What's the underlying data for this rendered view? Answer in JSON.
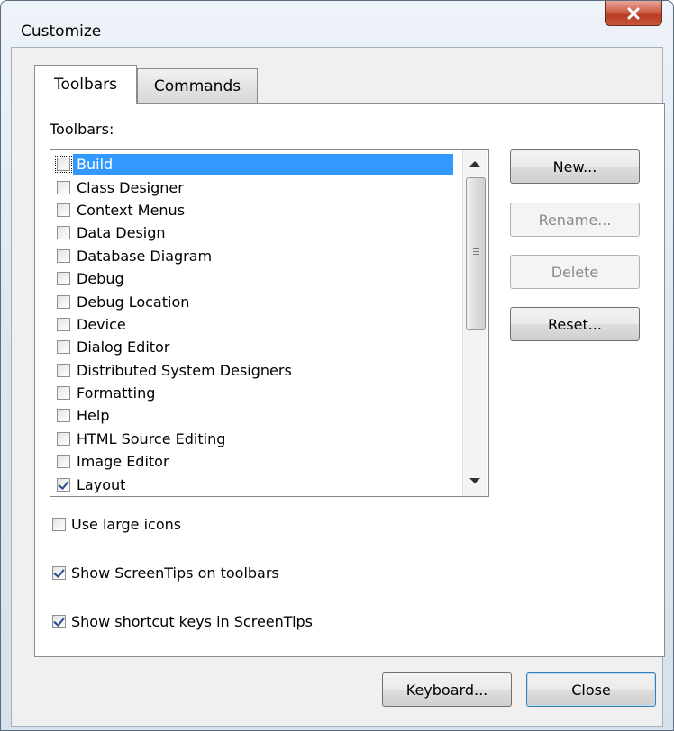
{
  "window": {
    "title": "Customize"
  },
  "tabs": [
    {
      "label": "Toolbars",
      "active": true
    },
    {
      "label": "Commands",
      "active": false
    }
  ],
  "toolbars_label": "Toolbars:",
  "toolbars": [
    {
      "label": "Build",
      "checked": false,
      "selected": true
    },
    {
      "label": "Class Designer",
      "checked": false
    },
    {
      "label": "Context Menus",
      "checked": false
    },
    {
      "label": "Data Design",
      "checked": false
    },
    {
      "label": "Database Diagram",
      "checked": false
    },
    {
      "label": "Debug",
      "checked": false
    },
    {
      "label": "Debug Location",
      "checked": false
    },
    {
      "label": "Device",
      "checked": false
    },
    {
      "label": "Dialog Editor",
      "checked": false
    },
    {
      "label": "Distributed System Designers",
      "checked": false
    },
    {
      "label": "Formatting",
      "checked": false
    },
    {
      "label": "Help",
      "checked": false
    },
    {
      "label": "HTML Source Editing",
      "checked": false
    },
    {
      "label": "Image Editor",
      "checked": false
    },
    {
      "label": "Layout",
      "checked": true
    }
  ],
  "buttons": {
    "new": "New...",
    "rename": "Rename...",
    "delete": "Delete",
    "reset": "Reset...",
    "keyboard": "Keyboard...",
    "close": "Close"
  },
  "options": [
    {
      "label": "Use large icons",
      "checked": false
    },
    {
      "label": "Show ScreenTips on toolbars",
      "checked": true
    },
    {
      "label": "Show shortcut keys in ScreenTips",
      "checked": true
    }
  ]
}
